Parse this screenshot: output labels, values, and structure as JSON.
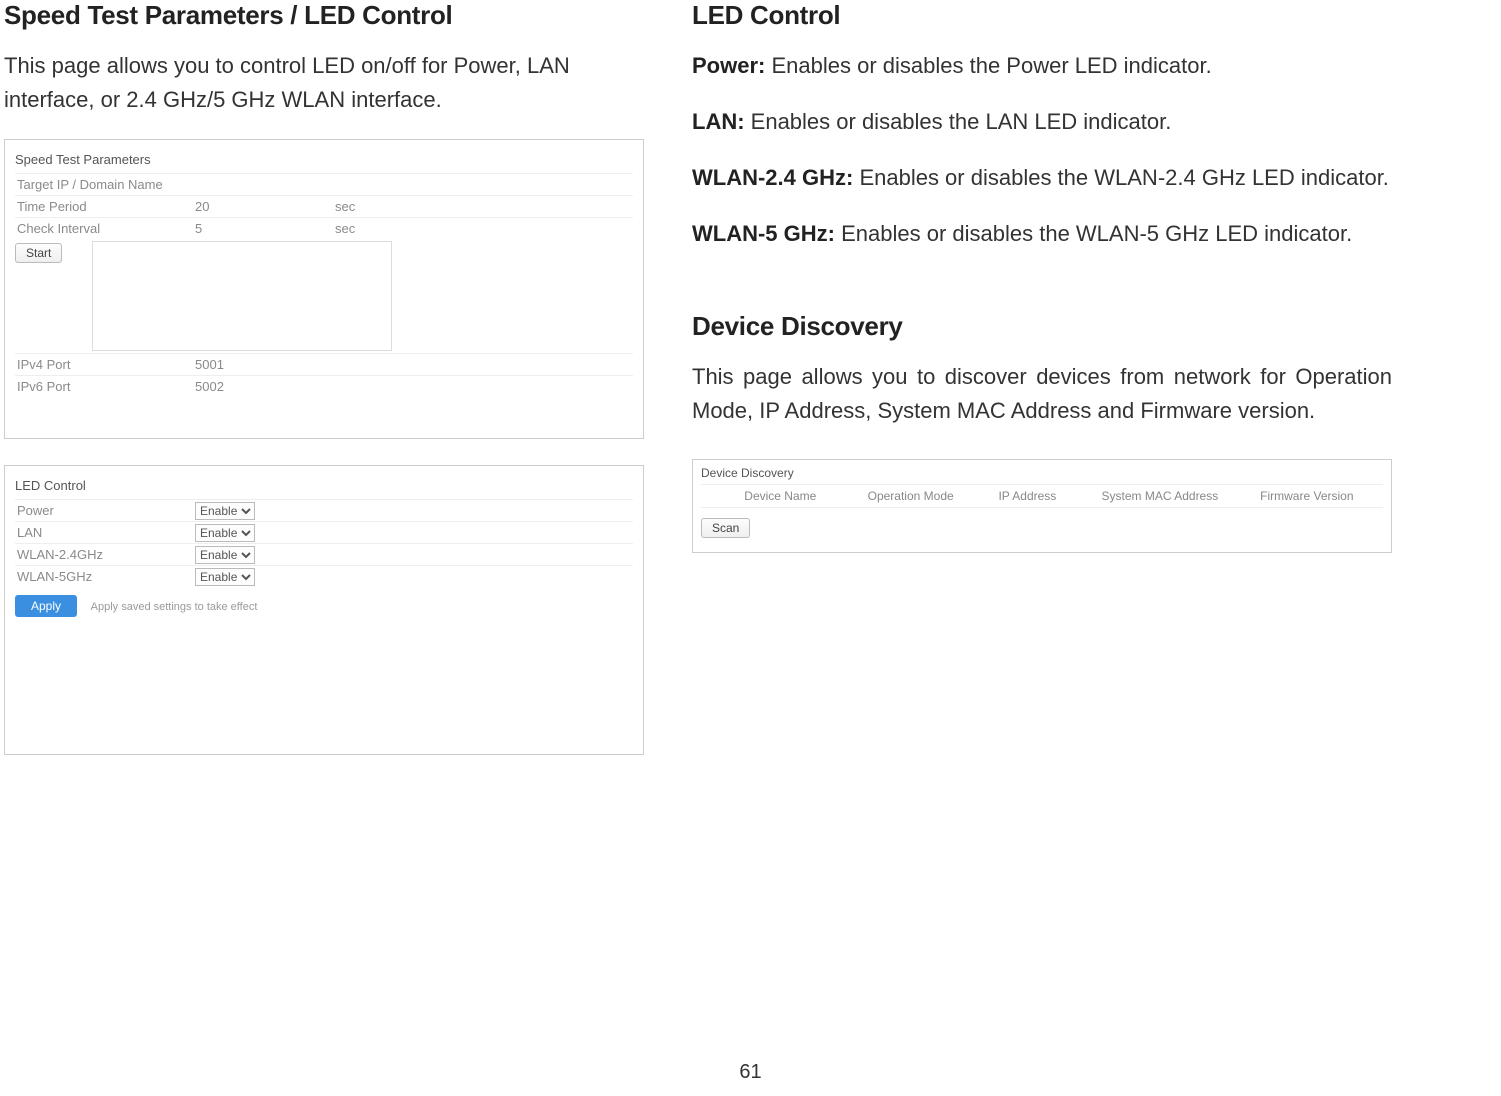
{
  "left": {
    "heading": "Speed Test Parameters / LED Control",
    "intro": "This page allows you to control LED on/off for Power, LAN interface, or 2.4 GHz/5 GHz WLAN interface.",
    "speed_box": {
      "title": "Speed Test Parameters",
      "rows": {
        "target_label": "Target IP / Domain Name",
        "time_label": "Time Period",
        "time_val": "20",
        "time_unit": "sec",
        "check_label": "Check Interval",
        "check_val": "5",
        "check_unit": "sec",
        "ipv4_label": "IPv4 Port",
        "ipv4_val": "5001",
        "ipv6_label": "IPv6 Port",
        "ipv6_val": "5002"
      },
      "start_btn": "Start"
    },
    "led_box": {
      "title": "LED Control",
      "rows": [
        {
          "label": "Power",
          "value": "Enable"
        },
        {
          "label": "LAN",
          "value": "Enable"
        },
        {
          "label": "WLAN-2.4GHz",
          "value": "Enable"
        },
        {
          "label": "WLAN-5GHz",
          "value": "Enable"
        }
      ],
      "apply_btn": "Apply",
      "apply_note": "Apply saved settings to take effect"
    }
  },
  "right": {
    "led_heading": "LED Control",
    "power_label": "Power:",
    "power_text": " Enables or disables the Power LED indicator.",
    "lan_label": "LAN:",
    "lan_text": " Enables or disables the LAN LED indicator.",
    "wlan24_label": "WLAN-2.4 GHz:",
    "wlan24_text": " Enables or disables the WLAN-2.4 GHz LED indicator.",
    "wlan5_label": "WLAN-5 GHz:",
    "wlan5_text": " Enables or disables the WLAN-5 GHz LED indicator.",
    "dd_heading": "Device Discovery",
    "dd_intro": "This page allows you to discover devices from network for Operation Mode, IP Address, System MAC Address and Firmware version.",
    "dd_box": {
      "title": "Device Discovery",
      "cols": {
        "c1": "Device Name",
        "c2": "Operation Mode",
        "c3": "IP Address",
        "c4": "System MAC Address",
        "c5": "Firmware Version"
      },
      "scan_btn": "Scan"
    }
  },
  "page_number": "61"
}
